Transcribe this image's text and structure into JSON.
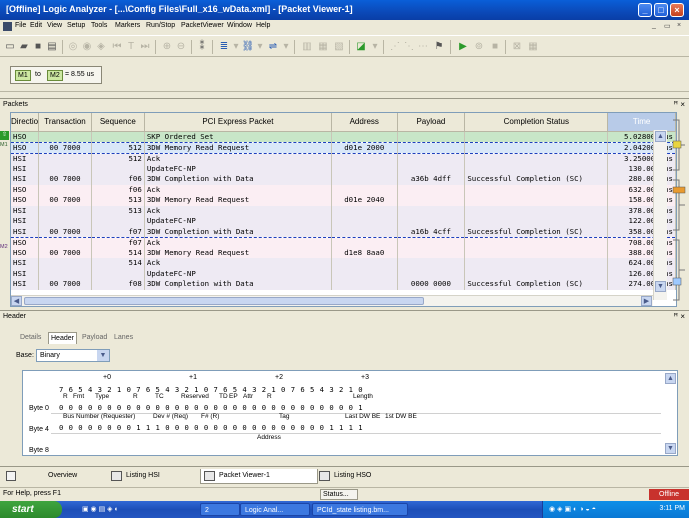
{
  "window": {
    "title": "[Offline]        Logic Analyzer - [...\\Config Files\\Full_x16_wData.xml] - [Packet Viewer-1]"
  },
  "menu": [
    "File",
    "Edit",
    "View",
    "Setup",
    "Tools",
    "Markers",
    "Run/Stop",
    "PacketViewer",
    "Window",
    "Help"
  ],
  "markers": {
    "m1": "M1",
    "to": "to",
    "m2": "M2",
    "delta": "= 8.55 us"
  },
  "packets_panel": {
    "title": "Packets",
    "columns": [
      "Directio",
      "Transaction",
      "Sequence",
      "PCI Express Packet",
      "Address",
      "Payload",
      "Completion Status",
      "Time"
    ],
    "rows": [
      [
        "HSO",
        "",
        "",
        "SKP Ordered Set",
        "",
        "",
        "",
        "5.028000 us"
      ],
      [
        "HSO",
        "00 7000",
        "512",
        "3DW Memory Read Request",
        "d01e 2000",
        "",
        "",
        "2.042000 us"
      ],
      [
        "HSI",
        "",
        "512",
        "Ack",
        "",
        "",
        "",
        "3.250000 us"
      ],
      [
        "HSI",
        "",
        "",
        "UpdateFC-NP",
        "",
        "",
        "",
        "130.000 ns"
      ],
      [
        "HSI",
        "00 7000",
        "f06",
        "3DW Completion with Data",
        "",
        "a36b 4dff",
        "Successful Completion (SC)",
        "280.000 ns"
      ],
      [
        "HSO",
        "",
        "f06",
        "Ack",
        "",
        "",
        "",
        "632.000 ns"
      ],
      [
        "HSO",
        "00 7000",
        "513",
        "3DW Memory Read Request",
        "d01e 2040",
        "",
        "",
        "158.000 ns"
      ],
      [
        "HSI",
        "",
        "513",
        "Ack",
        "",
        "",
        "",
        "378.000 ns"
      ],
      [
        "HSI",
        "",
        "",
        "UpdateFC-NP",
        "",
        "",
        "",
        "122.000 ns"
      ],
      [
        "HSI",
        "00 7000",
        "f07",
        "3DW Completion with Data",
        "",
        "a16b 4cff",
        "Successful Completion (SC)",
        "358.000 ns"
      ],
      [
        "HSO",
        "",
        "f07",
        "Ack",
        "",
        "",
        "",
        "708.000 ns"
      ],
      [
        "HSO",
        "00 7000",
        "514",
        "3DW Memory Read Request",
        "d1e8 8aa0",
        "",
        "",
        "388.000 ns"
      ],
      [
        "HSI",
        "",
        "514",
        "Ack",
        "",
        "",
        "",
        "624.000 ns"
      ],
      [
        "HSI",
        "",
        "",
        "UpdateFC-NP",
        "",
        "",
        "",
        "126.000 ns"
      ],
      [
        "HSI",
        "00 7000",
        "f08",
        "3DW Completion with Data",
        "",
        "0000 0000",
        "Successful Completion (SC)",
        "274.000 ns"
      ]
    ],
    "gutter_markers": [
      "M1",
      "M2"
    ]
  },
  "header_panel": {
    "title": "Header",
    "tabs": [
      "Details",
      "Header",
      "Payload",
      "Lanes"
    ],
    "active_tab": "Header",
    "base_label": "Base:",
    "base_value": "Binary",
    "byte_offsets": [
      "+0",
      "+1",
      "+2",
      "+3"
    ],
    "bit_numbers": "7 6 5 4 3 2 1 0   7 6 5 4 3 2 1 0   7 6 5 4 3 2 1 0   7 6 5 4 3 2 1 0",
    "byte0_fields": [
      "R",
      "Fmt",
      "Type",
      "R",
      "TC",
      "Reserved",
      "TD",
      "EP",
      "Attr",
      "R",
      "Length"
    ],
    "byte0_label": "Byte 0",
    "byte0_bits": "0 0 0 0 0 0 0 0   0 0 0 0 0 0 0 0   0 0 0 0 0 0 0 0   0 0 0 0 0 0 0 1",
    "byte4_fields": [
      "Bus Number (Requester)",
      "Dev # (Req)",
      "F# (R)",
      "Tag",
      "Last DW BE",
      "1st DW BE"
    ],
    "byte4_label": "Byte 4",
    "byte4_bits": "0 0 0 0 0 0 0 0   1 1 1 0 0 0 0 0   0 0 0 0 0 0 0 0   0 0 0 0 1 1 1 1",
    "byte8_fields": [
      "Address"
    ],
    "byte8_label": "Byte 8"
  },
  "bottom_tabs": [
    "Overview",
    "Listing HSI",
    "Packet Viewer-1",
    "Listing HSO"
  ],
  "active_bottom_tab": "Packet Viewer-1",
  "status": {
    "help": "For Help, press F1",
    "button": "Status...",
    "badge": "Offline"
  },
  "taskbar": {
    "start": "start",
    "tasks": [
      "2",
      "Logic Anal...",
      "PCId_state listing.bm..."
    ],
    "clock": "3:11 PM"
  },
  "colors": {
    "skp_row": "#c8e6c8",
    "selected_row": "#d9e7f8",
    "inbound_row": "#eeeaf3",
    "outbound_row": "#fbeef3",
    "offline_badge": "#c8322d",
    "titlebar": "#0a5fd8"
  }
}
